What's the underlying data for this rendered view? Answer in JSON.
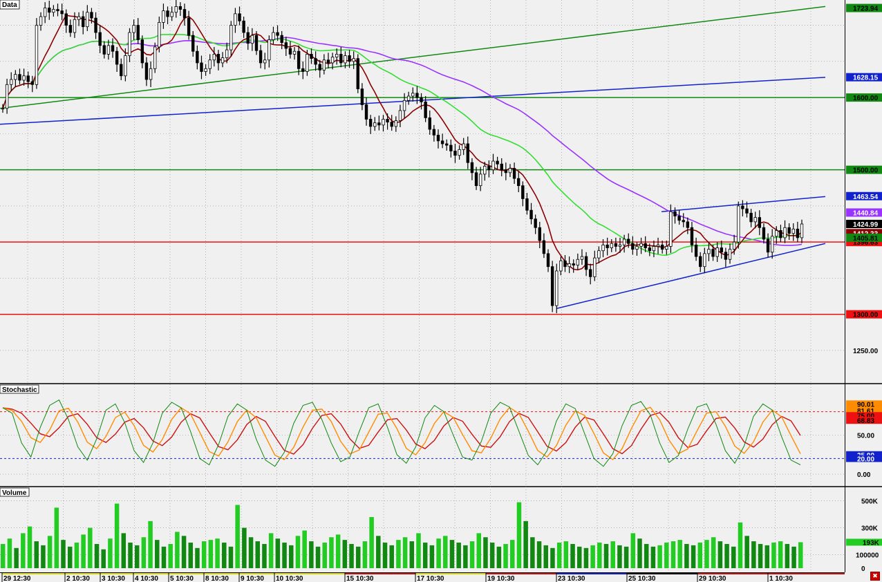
{
  "colors": {
    "background": "#f0f0f0",
    "candle": "#000000",
    "sma_red": "#8b0000",
    "sma_green": "#33dd33",
    "sma_purple": "#9933ff",
    "trend_green": "#118811",
    "trend_blue": "#1122cc",
    "level_green": "#118811",
    "level_red": "#ee1111",
    "stoch_k": "#118811",
    "stoch_d1": "#ff8c00",
    "stoch_d2": "#cc1111",
    "volume_up": "#22cc22",
    "volume_down": "#118811"
  },
  "chart_data": [
    {
      "panel": "price",
      "type": "candlestick",
      "title": "Data",
      "ylim": [
        1205,
        1735
      ],
      "grid": true,
      "y_ticks": [
        1250.0
      ],
      "levels": [
        {
          "value": 1600.0,
          "color": "green",
          "label": "1600.00"
        },
        {
          "value": 1500.0,
          "color": "green",
          "label": "1500.00"
        },
        {
          "value": 1300.0,
          "color": "red",
          "label": "1300.00"
        },
        {
          "value": 1400.0,
          "color": "red",
          "label": "1396.63"
        }
      ],
      "price_tags": [
        {
          "value": 1723.94,
          "label": "1723.94",
          "color": "green"
        },
        {
          "value": 1628.15,
          "label": "1628.15",
          "color": "blue"
        },
        {
          "value": 1463.54,
          "label": "1463.54",
          "color": "blue"
        },
        {
          "value": 1440.84,
          "label": "1440.84",
          "color": "purple"
        },
        {
          "value": 1424.99,
          "label": "1424.99",
          "color": "black"
        },
        {
          "value": 1412.33,
          "label": "1412.33",
          "color": "darkred"
        },
        {
          "value": 1406.0,
          "label": "1405.81",
          "color": "green"
        }
      ],
      "trendlines": [
        {
          "color": "green",
          "from": [
            0,
            1585
          ],
          "to": [
            1194,
            1726
          ]
        },
        {
          "color": "blue",
          "from": [
            0,
            1563
          ],
          "to": [
            1194,
            1628
          ]
        },
        {
          "color": "blue",
          "from": [
            957,
            1442
          ],
          "to": [
            1194,
            1463
          ]
        },
        {
          "color": "blue",
          "from": [
            805,
            1308
          ],
          "to": [
            1194,
            1398
          ]
        }
      ],
      "candles": [
        {
          "c": 1585
        },
        {
          "c": 1618
        },
        {
          "c": 1625
        },
        {
          "c": 1632
        },
        {
          "c": 1624
        },
        {
          "c": 1630
        },
        {
          "c": 1622
        },
        {
          "c": 1618
        },
        {
          "c": 1700
        },
        {
          "c": 1712
        },
        {
          "c": 1724
        },
        {
          "c": 1718
        },
        {
          "c": 1722
        },
        {
          "c": 1720
        },
        {
          "c": 1716
        },
        {
          "c": 1700
        },
        {
          "c": 1690
        },
        {
          "c": 1708
        },
        {
          "c": 1712
        },
        {
          "c": 1698
        },
        {
          "c": 1718
        },
        {
          "c": 1710
        },
        {
          "c": 1690
        },
        {
          "c": 1672
        },
        {
          "c": 1660
        },
        {
          "c": 1672
        },
        {
          "c": 1664
        },
        {
          "c": 1646
        },
        {
          "c": 1630
        },
        {
          "c": 1658
        },
        {
          "c": 1690
        },
        {
          "c": 1700
        },
        {
          "c": 1680
        },
        {
          "c": 1648
        },
        {
          "c": 1625
        },
        {
          "c": 1640
        },
        {
          "c": 1670
        },
        {
          "c": 1704
        },
        {
          "c": 1720
        },
        {
          "c": 1712
        },
        {
          "c": 1718
        },
        {
          "c": 1726
        },
        {
          "c": 1722
        },
        {
          "c": 1710
        },
        {
          "c": 1686
        },
        {
          "c": 1664
        },
        {
          "c": 1648
        },
        {
          "c": 1636
        },
        {
          "c": 1640
        },
        {
          "c": 1652
        },
        {
          "c": 1660
        },
        {
          "c": 1648
        },
        {
          "c": 1655
        },
        {
          "c": 1666
        },
        {
          "c": 1700
        },
        {
          "c": 1716
        },
        {
          "c": 1706
        },
        {
          "c": 1690
        },
        {
          "c": 1675
        },
        {
          "c": 1686
        },
        {
          "c": 1665
        },
        {
          "c": 1648
        },
        {
          "c": 1652
        },
        {
          "c": 1680
        },
        {
          "c": 1690
        },
        {
          "c": 1686
        },
        {
          "c": 1676
        },
        {
          "c": 1668
        },
        {
          "c": 1660
        },
        {
          "c": 1664
        },
        {
          "c": 1640
        },
        {
          "c": 1636
        },
        {
          "c": 1660
        },
        {
          "c": 1654
        },
        {
          "c": 1646
        },
        {
          "c": 1638
        },
        {
          "c": 1652
        },
        {
          "c": 1648
        },
        {
          "c": 1656
        },
        {
          "c": 1660
        },
        {
          "c": 1648
        },
        {
          "c": 1658
        },
        {
          "c": 1650
        },
        {
          "c": 1654
        },
        {
          "c": 1612
        },
        {
          "c": 1590
        },
        {
          "c": 1570
        },
        {
          "c": 1560
        },
        {
          "c": 1565
        },
        {
          "c": 1562
        },
        {
          "c": 1570
        },
        {
          "c": 1566
        },
        {
          "c": 1560
        },
        {
          "c": 1568
        },
        {
          "c": 1582
        },
        {
          "c": 1596
        },
        {
          "c": 1602
        },
        {
          "c": 1606
        },
        {
          "c": 1600
        },
        {
          "c": 1594
        },
        {
          "c": 1572
        },
        {
          "c": 1556
        },
        {
          "c": 1548
        },
        {
          "c": 1540
        },
        {
          "c": 1536
        },
        {
          "c": 1534
        },
        {
          "c": 1526
        },
        {
          "c": 1520
        },
        {
          "c": 1528
        },
        {
          "c": 1536
        },
        {
          "c": 1510
        },
        {
          "c": 1496
        },
        {
          "c": 1478
        },
        {
          "c": 1494
        },
        {
          "c": 1505
        },
        {
          "c": 1500
        },
        {
          "c": 1512
        },
        {
          "c": 1508
        },
        {
          "c": 1500
        },
        {
          "c": 1496
        },
        {
          "c": 1502
        },
        {
          "c": 1488
        },
        {
          "c": 1478
        },
        {
          "c": 1460
        },
        {
          "c": 1444
        },
        {
          "c": 1432
        },
        {
          "c": 1420
        },
        {
          "c": 1402
        },
        {
          "c": 1384
        },
        {
          "c": 1366
        },
        {
          "c": 1312
        },
        {
          "c": 1360
        },
        {
          "c": 1374
        },
        {
          "c": 1366
        },
        {
          "c": 1370
        },
        {
          "c": 1368
        },
        {
          "c": 1376
        },
        {
          "c": 1380
        },
        {
          "c": 1362
        },
        {
          "c": 1352
        },
        {
          "c": 1378
        },
        {
          "c": 1388
        },
        {
          "c": 1396
        },
        {
          "c": 1392
        },
        {
          "c": 1398
        },
        {
          "c": 1394
        },
        {
          "c": 1396
        },
        {
          "c": 1404
        },
        {
          "c": 1398
        },
        {
          "c": 1390
        },
        {
          "c": 1394
        },
        {
          "c": 1398
        },
        {
          "c": 1392
        },
        {
          "c": 1388
        },
        {
          "c": 1394
        },
        {
          "c": 1396
        },
        {
          "c": 1390
        },
        {
          "c": 1394
        },
        {
          "c": 1442
        },
        {
          "c": 1436
        },
        {
          "c": 1430
        },
        {
          "c": 1428
        },
        {
          "c": 1420
        },
        {
          "c": 1396
        },
        {
          "c": 1380
        },
        {
          "c": 1366
        },
        {
          "c": 1384
        },
        {
          "c": 1390
        },
        {
          "c": 1380
        },
        {
          "c": 1392
        },
        {
          "c": 1386
        },
        {
          "c": 1376
        },
        {
          "c": 1390
        },
        {
          "c": 1400
        },
        {
          "c": 1450
        },
        {
          "c": 1446
        },
        {
          "c": 1440
        },
        {
          "c": 1428
        },
        {
          "c": 1434
        },
        {
          "c": 1420
        },
        {
          "c": 1404
        },
        {
          "c": 1386
        },
        {
          "c": 1408
        },
        {
          "c": 1416
        },
        {
          "c": 1406
        },
        {
          "c": 1420
        },
        {
          "c": 1412
        },
        {
          "c": 1418
        },
        {
          "c": 1406
        },
        {
          "c": 1425
        }
      ]
    },
    {
      "panel": "stochastic",
      "type": "line",
      "title": "Stochastic",
      "ylim": [
        -15,
        115
      ],
      "y_ticks": [
        50.0,
        0.0
      ],
      "levels": [
        {
          "value": 80,
          "color": "red",
          "style": "dashed"
        },
        {
          "value": 20,
          "color": "blue",
          "style": "dashed"
        }
      ],
      "tags": [
        {
          "value": 90.0,
          "label": "90.01",
          "color": "orange"
        },
        {
          "value": 81.61,
          "label": "81.61",
          "color": "orange"
        },
        {
          "value": 75.0,
          "label": "75.00",
          "color": "red"
        },
        {
          "value": 68.83,
          "label": "68.83",
          "color": "red"
        },
        {
          "value": 25.0,
          "label": "25.00",
          "color": "blue"
        },
        {
          "value": 20.0,
          "label": "20.00",
          "color": "blue"
        }
      ],
      "series": [
        {
          "name": "",
          "values": [
            85,
            78,
            40,
            22,
            60,
            88,
            95,
            70,
            35,
            18,
            45,
            82,
            90,
            66,
            30,
            15,
            40,
            78,
            92,
            85,
            55,
            20,
            12,
            38,
            74,
            90,
            82,
            45,
            18,
            10,
            28,
            65,
            88,
            92,
            70,
            40,
            16,
            22,
            55,
            85,
            90,
            60,
            25,
            14,
            35,
            72,
            88,
            80,
            50,
            22,
            18,
            42,
            78,
            92,
            86,
            55,
            24,
            12,
            30,
            68,
            90,
            84,
            52,
            20,
            10,
            26,
            62,
            88,
            93,
            76,
            40,
            15,
            24,
            58,
            86,
            90,
            64,
            30,
            14,
            36,
            74,
            90,
            82,
            48,
            18,
            12
          ]
        }
      ]
    },
    {
      "panel": "volume",
      "type": "bar",
      "title": "Volume",
      "ylim": [
        0,
        560000
      ],
      "y_ticks": [
        {
          "value": 500000,
          "label": "500K"
        },
        {
          "value": 300000,
          "label": "300K"
        },
        {
          "value": 100000,
          "label": "100000"
        },
        {
          "value": 0,
          "label": "0"
        }
      ],
      "last_tag": {
        "value": 193000,
        "label": "193K"
      },
      "values": [
        180000,
        220000,
        150000,
        260000,
        310000,
        200000,
        170000,
        240000,
        450000,
        210000,
        160000,
        190000,
        250000,
        300000,
        180000,
        140000,
        220000,
        480000,
        260000,
        190000,
        170000,
        230000,
        350000,
        210000,
        160000,
        180000,
        270000,
        240000,
        190000,
        150000,
        200000,
        210000,
        220000,
        190000,
        160000,
        470000,
        300000,
        230000,
        200000,
        180000,
        260000,
        220000,
        190000,
        170000,
        240000,
        280000,
        200000,
        160000,
        190000,
        230000,
        250000,
        210000,
        180000,
        160000,
        200000,
        380000,
        240000,
        190000,
        170000,
        210000,
        230000,
        200000,
        260000,
        190000,
        170000,
        220000,
        240000,
        210000,
        190000,
        170000,
        200000,
        260000,
        230000,
        190000,
        160000,
        180000,
        210000,
        490000,
        350000,
        230000,
        200000,
        170000,
        150000,
        190000,
        200000,
        180000,
        160000,
        150000,
        170000,
        190000,
        180000,
        200000,
        170000,
        160000,
        260000,
        220000,
        180000,
        160000,
        170000,
        190000,
        200000,
        210000,
        180000,
        170000,
        190000,
        210000,
        230000,
        200000,
        180000,
        160000,
        340000,
        240000,
        200000,
        180000,
        170000,
        190000,
        200000,
        180000,
        160000,
        193000
      ]
    }
  ],
  "x_axis": {
    "labels": [
      "29 12:30",
      "2 10:30",
      "3 10:30",
      "4 10:30",
      "5 10:30",
      "8 10:30",
      "9 10:30",
      "10 10:30",
      "15 10:30",
      "17 10:30",
      "19 10:30",
      "23 10:30",
      "25 10:30",
      "29 10:30",
      "1 10:30"
    ]
  }
}
